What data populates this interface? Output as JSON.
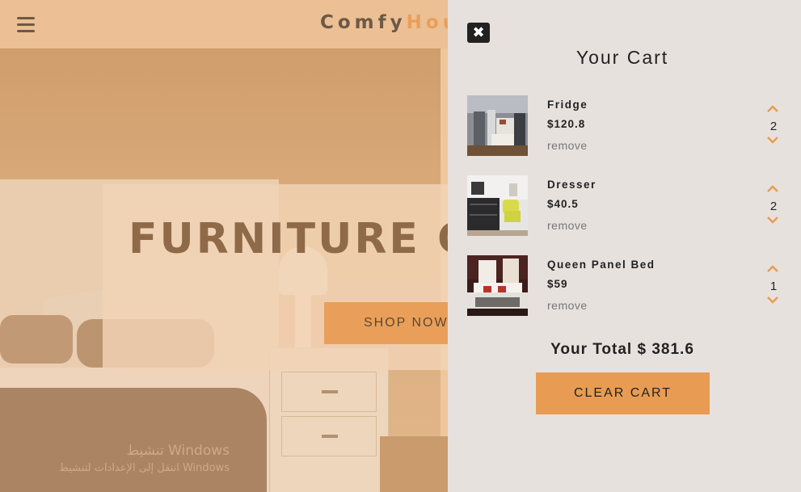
{
  "navbar": {
    "logo_prefix": "Comfy",
    "logo_accent": "Hou"
  },
  "hero": {
    "title": "FURNITURE CO",
    "button_label": "SHOP NOW"
  },
  "watermark": {
    "line1": "تنشيط Windows",
    "line2": "انتقل إلى الإعدادات لتنشيط Windows"
  },
  "cart": {
    "close_icon": "close-icon",
    "title": "Your Cart",
    "items": [
      {
        "name": "Fridge",
        "price": "$120.8",
        "remove_label": "remove",
        "quantity": "2"
      },
      {
        "name": "Dresser",
        "price": "$40.5",
        "remove_label": "remove",
        "quantity": "2"
      },
      {
        "name": "Queen Panel Bed",
        "price": "$59",
        "remove_label": "remove",
        "quantity": "1"
      }
    ],
    "total_text": "Your Total $ 381.6",
    "clear_label": "CLEAR CART"
  },
  "colors": {
    "accent": "#e89c53",
    "cart_background": "#e7e1de",
    "navbar": "#ecc39c",
    "text_dark": "#222222"
  },
  "icons": {
    "menu": "menu-icon",
    "increase": "chevron-up-icon",
    "decrease": "chevron-down-icon"
  }
}
